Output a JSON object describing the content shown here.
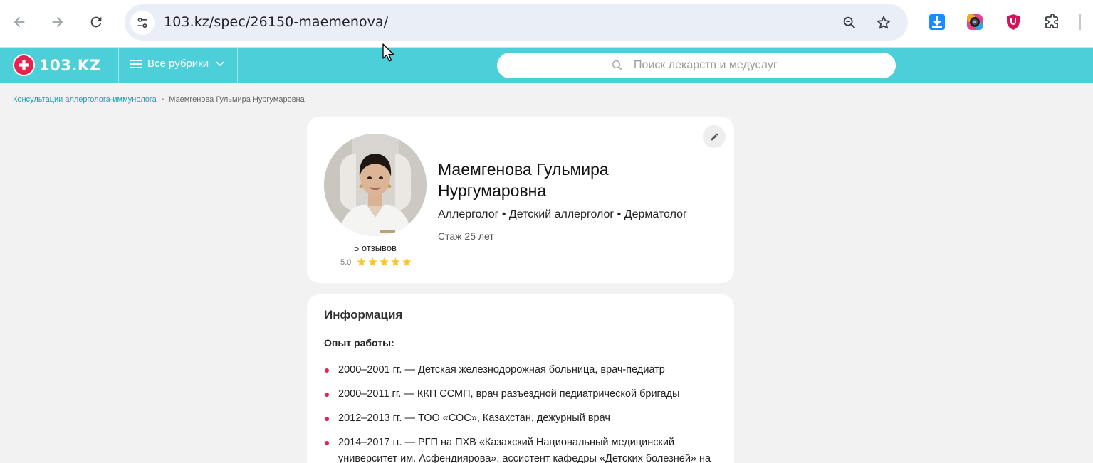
{
  "browser": {
    "url": "103.kz/spec/26150-maemenova/"
  },
  "site": {
    "logo_text": "103.KZ",
    "rubrics_label": "Все рубрики",
    "search_placeholder": "Поиск лекарств и медуслуг"
  },
  "breadcrumbs": {
    "parent": "Консультации аллерголога-иммунолога",
    "current": "Маемгенова Гульмира Нургумаровна"
  },
  "profile": {
    "name": "Маемгенова Гульмира Нургумаровна",
    "specialties": "Аллерголог • Детский аллерголог • Дерматолог",
    "experience": "Стаж 25 лет",
    "reviews": "5 отзывов",
    "rating": "5.0",
    "stars": 5,
    "star_color": "#f7c531"
  },
  "info": {
    "title": "Информация",
    "work_label": "Опыт работы:",
    "work_items": [
      "2000–2001 гг. — Детская железнодорожная больница, врач-педиатр",
      "2000–2011 гг. — ККП ССМП, врач разъездной педиатрической бригады",
      "2012–2013 гг. — ТОО «СОС», Казахстан, дежурный врач",
      "2014–2017 гг. — РГП на ПХВ «Казахский Национальный медицинский университет им. Асфендиярова», ассистент кафедры «Детских болезней» на"
    ]
  },
  "colors": {
    "header": "#4ccfd8",
    "accent": "#e8214d",
    "link": "#1aa3b0"
  }
}
